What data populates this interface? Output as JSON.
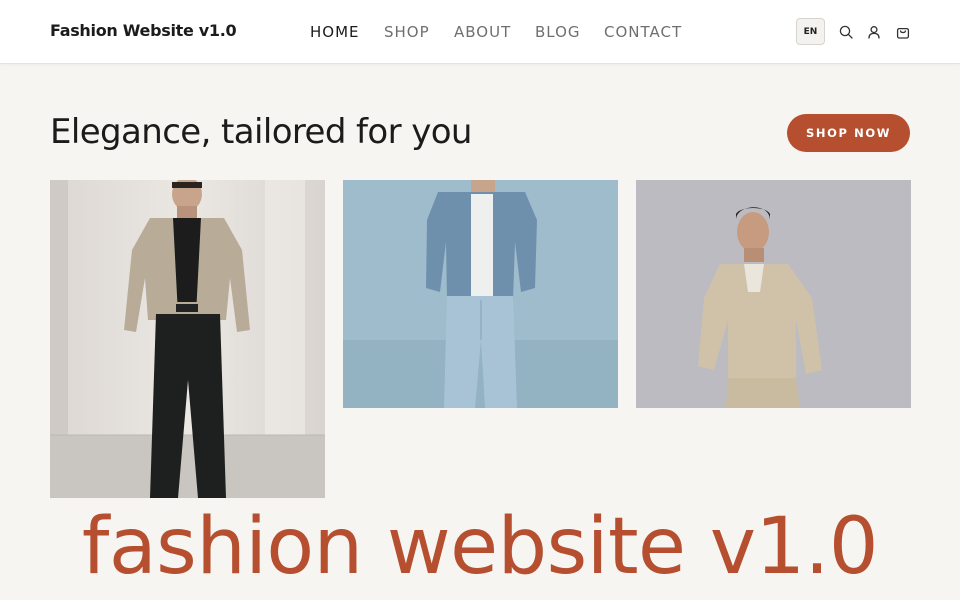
{
  "brand": "Fashion Website v1.0",
  "nav": {
    "items": [
      {
        "label": "HOME",
        "active": true
      },
      {
        "label": "SHOP",
        "active": false
      },
      {
        "label": "ABOUT",
        "active": false
      },
      {
        "label": "BLOG",
        "active": false
      },
      {
        "label": "CONTACT",
        "active": false
      }
    ]
  },
  "header_actions": {
    "language": "EN",
    "icons": [
      "search-icon",
      "user-icon",
      "cart-icon"
    ]
  },
  "hero": {
    "title": "Elegance, tailored for you",
    "cta_label": "SHOP NOW"
  },
  "gallery": {
    "images": [
      {
        "subject": "man in beige jacket and black trousers"
      },
      {
        "subject": "man in denim jacket and jeans"
      },
      {
        "subject": "man in beige overshirt leaning on wall"
      }
    ]
  },
  "wordmark": "fashion website v1.0",
  "colors": {
    "accent": "#b54f2f",
    "background": "#f7f5f1",
    "header_bg": "#ffffff",
    "text": "#1b1b1b",
    "nav_inactive": "#6f6f6f"
  }
}
